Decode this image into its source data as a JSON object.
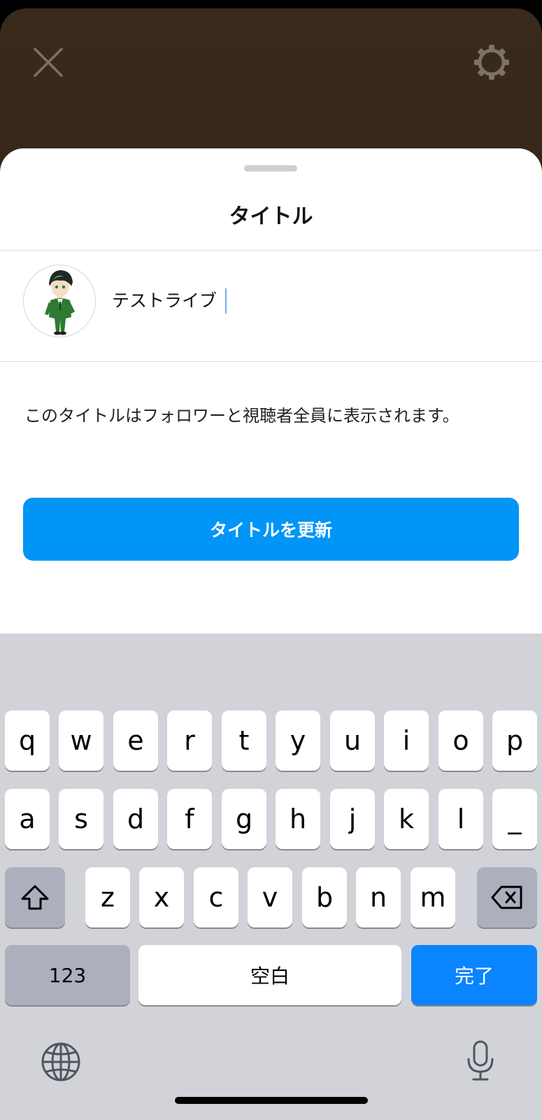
{
  "header": {
    "close_icon": "close-icon",
    "settings_icon": "gear-icon"
  },
  "sheet": {
    "title": "タイトル",
    "input_value": "テストライブ",
    "description": "このタイトルはフォロワーと視聴者全員に表示されます。",
    "update_button": "タイトルを更新",
    "accent_color": "#0095f6"
  },
  "keyboard": {
    "row1": [
      "q",
      "w",
      "e",
      "r",
      "t",
      "y",
      "u",
      "i",
      "o",
      "p"
    ],
    "row2": [
      "a",
      "s",
      "d",
      "f",
      "g",
      "h",
      "j",
      "k",
      "l",
      "_"
    ],
    "row3": [
      "z",
      "x",
      "c",
      "v",
      "b",
      "n",
      "m"
    ],
    "shift_icon": "shift-icon",
    "delete_icon": "delete-icon",
    "numbers_label": "123",
    "space_label": "空白",
    "done_label": "完了",
    "done_color": "#0a84ff",
    "globe_icon": "globe-icon",
    "mic_icon": "microphone-icon"
  }
}
